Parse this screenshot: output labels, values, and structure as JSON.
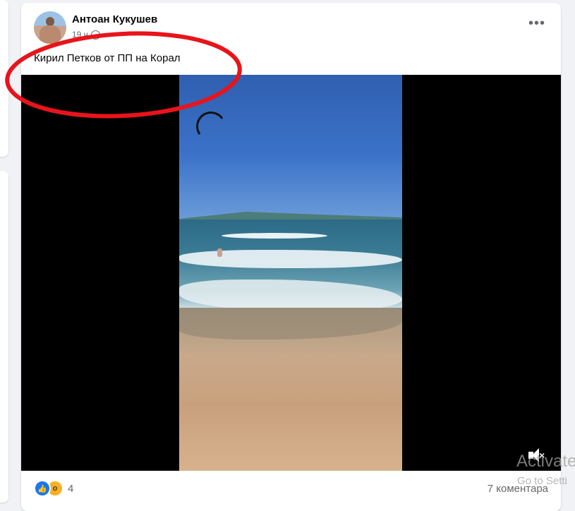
{
  "post": {
    "author": "Антоан Кукушев",
    "timestamp": "19 ч",
    "text": "Кирил Петков от ПП на Корал",
    "more_icon": "more-horizontal-icon"
  },
  "video": {
    "description": "",
    "muted_icon": "volume-muted-icon"
  },
  "footer": {
    "reaction_count": "4",
    "comments": "7 коментара",
    "reaction_icons": [
      "like-icon",
      "wow-icon"
    ]
  },
  "watermark": {
    "line1": "Activate",
    "line2": "Go to Setti"
  },
  "colors": {
    "annotation_red": "#e8141b",
    "like_blue": "#1877f2"
  }
}
